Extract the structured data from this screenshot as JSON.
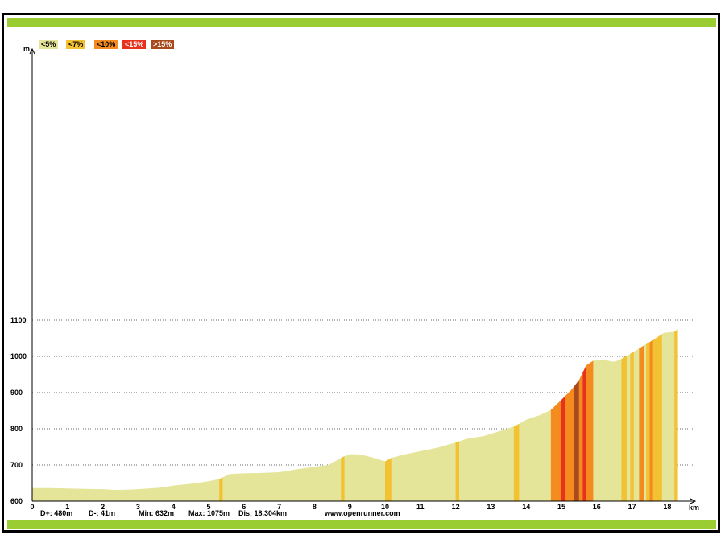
{
  "chart_data": {
    "type": "area",
    "ylabel": "m",
    "xlabel": "km",
    "xlim": [
      0,
      18.5
    ],
    "ylim": [
      600,
      1100
    ],
    "x_ticks": [
      "0",
      "1",
      "2",
      "3",
      "4",
      "5",
      "6",
      "7",
      "8",
      "9",
      "10",
      "11",
      "12",
      "13",
      "14",
      "15",
      "16",
      "17",
      "18"
    ],
    "y_ticks": [
      "600",
      "700",
      "800",
      "900",
      "1000",
      "1100"
    ],
    "legend": [
      {
        "label": "<5%",
        "color": "#e5e59a"
      },
      {
        "label": "<7%",
        "color": "#f3c233"
      },
      {
        "label": "<10%",
        "color": "#f58b1f"
      },
      {
        "label": "<15%",
        "color": "#e7321c"
      },
      {
        "label": ">15%",
        "color": "#a84a1c"
      }
    ],
    "grid": "horizontal dotted",
    "profile": [
      {
        "x": 0.0,
        "y": 636
      },
      {
        "x": 0.5,
        "y": 636
      },
      {
        "x": 1.0,
        "y": 635
      },
      {
        "x": 1.5,
        "y": 634
      },
      {
        "x": 2.0,
        "y": 633
      },
      {
        "x": 2.3,
        "y": 631
      },
      {
        "x": 2.5,
        "y": 631
      },
      {
        "x": 2.8,
        "y": 632
      },
      {
        "x": 3.0,
        "y": 633
      },
      {
        "x": 3.3,
        "y": 635
      },
      {
        "x": 3.6,
        "y": 637
      },
      {
        "x": 4.0,
        "y": 643
      },
      {
        "x": 4.5,
        "y": 648
      },
      {
        "x": 5.0,
        "y": 655
      },
      {
        "x": 5.3,
        "y": 661
      },
      {
        "x": 5.6,
        "y": 675
      },
      {
        "x": 6.0,
        "y": 677
      },
      {
        "x": 6.5,
        "y": 678
      },
      {
        "x": 7.0,
        "y": 680
      },
      {
        "x": 7.5,
        "y": 688
      },
      {
        "x": 8.0,
        "y": 695
      },
      {
        "x": 8.4,
        "y": 700
      },
      {
        "x": 8.8,
        "y": 722
      },
      {
        "x": 9.0,
        "y": 730
      },
      {
        "x": 9.3,
        "y": 729
      },
      {
        "x": 9.6,
        "y": 722
      },
      {
        "x": 10.0,
        "y": 710
      },
      {
        "x": 10.2,
        "y": 720
      },
      {
        "x": 10.5,
        "y": 728
      },
      {
        "x": 11.0,
        "y": 738
      },
      {
        "x": 11.5,
        "y": 748
      },
      {
        "x": 12.0,
        "y": 762
      },
      {
        "x": 12.3,
        "y": 772
      },
      {
        "x": 12.8,
        "y": 780
      },
      {
        "x": 13.3,
        "y": 795
      },
      {
        "x": 13.7,
        "y": 808
      },
      {
        "x": 14.0,
        "y": 825
      },
      {
        "x": 14.4,
        "y": 838
      },
      {
        "x": 14.7,
        "y": 852
      },
      {
        "x": 15.0,
        "y": 880
      },
      {
        "x": 15.3,
        "y": 910
      },
      {
        "x": 15.5,
        "y": 935
      },
      {
        "x": 15.7,
        "y": 975
      },
      {
        "x": 15.9,
        "y": 988
      },
      {
        "x": 16.2,
        "y": 990
      },
      {
        "x": 16.5,
        "y": 985
      },
      {
        "x": 16.7,
        "y": 993
      },
      {
        "x": 17.0,
        "y": 1010
      },
      {
        "x": 17.3,
        "y": 1028
      },
      {
        "x": 17.6,
        "y": 1045
      },
      {
        "x": 17.9,
        "y": 1065
      },
      {
        "x": 18.2,
        "y": 1068
      },
      {
        "x": 18.3,
        "y": 1075
      }
    ],
    "slope_segments": [
      {
        "from": 5.3,
        "to": 5.4,
        "class": "<7%"
      },
      {
        "from": 8.75,
        "to": 8.85,
        "class": "<7%"
      },
      {
        "from": 10.0,
        "to": 10.2,
        "class": "<7%"
      },
      {
        "from": 12.0,
        "to": 12.1,
        "class": "<7%"
      },
      {
        "from": 13.65,
        "to": 13.8,
        "class": "<7%"
      },
      {
        "from": 14.7,
        "to": 14.85,
        "class": "<10%"
      },
      {
        "from": 14.85,
        "to": 15.0,
        "class": "<10%"
      },
      {
        "from": 15.0,
        "to": 15.1,
        "class": "<15%"
      },
      {
        "from": 15.1,
        "to": 15.35,
        "class": "<10%"
      },
      {
        "from": 15.35,
        "to": 15.5,
        "class": ">15%"
      },
      {
        "from": 15.5,
        "to": 15.6,
        "class": "<10%"
      },
      {
        "from": 15.6,
        "to": 15.7,
        "class": "<15%"
      },
      {
        "from": 15.7,
        "to": 15.9,
        "class": "<10%"
      },
      {
        "from": 16.7,
        "to": 16.85,
        "class": "<7%"
      },
      {
        "from": 16.95,
        "to": 17.05,
        "class": "<7%"
      },
      {
        "from": 17.2,
        "to": 17.35,
        "class": "<10%"
      },
      {
        "from": 17.4,
        "to": 17.5,
        "class": "<7%"
      },
      {
        "from": 17.5,
        "to": 17.6,
        "class": "<10%"
      },
      {
        "from": 17.6,
        "to": 17.85,
        "class": "<7%"
      },
      {
        "from": 18.2,
        "to": 18.3,
        "class": "<7%"
      }
    ]
  },
  "stats": {
    "d_plus": "D+: 480m",
    "d_minus": "D-: 41m",
    "min": "Min: 632m",
    "max": "Max: 1075m",
    "dist": "Dis: 18.304km",
    "site": "www.openrunner.com"
  }
}
